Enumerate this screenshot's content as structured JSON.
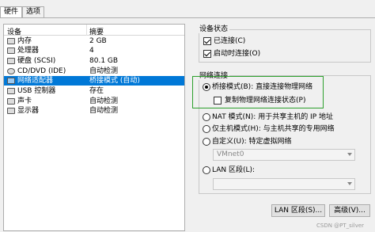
{
  "tabs": [
    {
      "label": "硬件",
      "active": true
    },
    {
      "label": "选项",
      "active": false
    }
  ],
  "device_list": {
    "col_device": "设备",
    "col_summary": "摘要",
    "rows": [
      {
        "name": "内存",
        "summary": "2 GB",
        "icon": "memory-icon"
      },
      {
        "name": "处理器",
        "summary": "4",
        "icon": "cpu-icon"
      },
      {
        "name": "硬盘 (SCSI)",
        "summary": "80.1 GB",
        "icon": "harddisk-icon"
      },
      {
        "name": "CD/DVD (IDE)",
        "summary": "自动检测",
        "icon": "cd-dvd-icon"
      },
      {
        "name": "网络适配器",
        "summary": "桥接模式 (自动)",
        "icon": "network-adapter-icon",
        "selected": true
      },
      {
        "name": "USB 控制器",
        "summary": "存在",
        "icon": "usb-icon"
      },
      {
        "name": "声卡",
        "summary": "自动检测",
        "icon": "sound-card-icon"
      },
      {
        "name": "显示器",
        "summary": "自动检测",
        "icon": "display-icon"
      }
    ]
  },
  "device_status": {
    "title": "设备状态",
    "connected": {
      "label": "已连接(C)",
      "checked": true
    },
    "connect_at_power_on": {
      "label": "启动时连接(O)",
      "checked": true
    }
  },
  "network_connection": {
    "title": "网络连接",
    "bridged": {
      "label": "桥接模式(B): 直接连接物理网络",
      "selected": true
    },
    "replicate": {
      "label": "复制物理网络连接状态(P)",
      "checked": false
    },
    "nat": {
      "label": "NAT 模式(N): 用于共享主机的 IP 地址",
      "selected": false
    },
    "host_only": {
      "label": "仅主机模式(H): 与主机共享的专用网络",
      "selected": false
    },
    "custom": {
      "label": "自定义(U): 特定虚拟网络",
      "selected": false
    },
    "custom_combo": {
      "value": "VMnet0"
    },
    "lan_segment": {
      "label": "LAN 区段(L):",
      "selected": false
    },
    "lan_combo": {
      "value": ""
    }
  },
  "buttons": {
    "lan_segments": "LAN 区段(S)...",
    "advanced": "高级(V)..."
  },
  "watermark": "CSDN @PT_silver",
  "colors": {
    "selection": "#0078d7",
    "highlight_box": "#2ca02c"
  }
}
